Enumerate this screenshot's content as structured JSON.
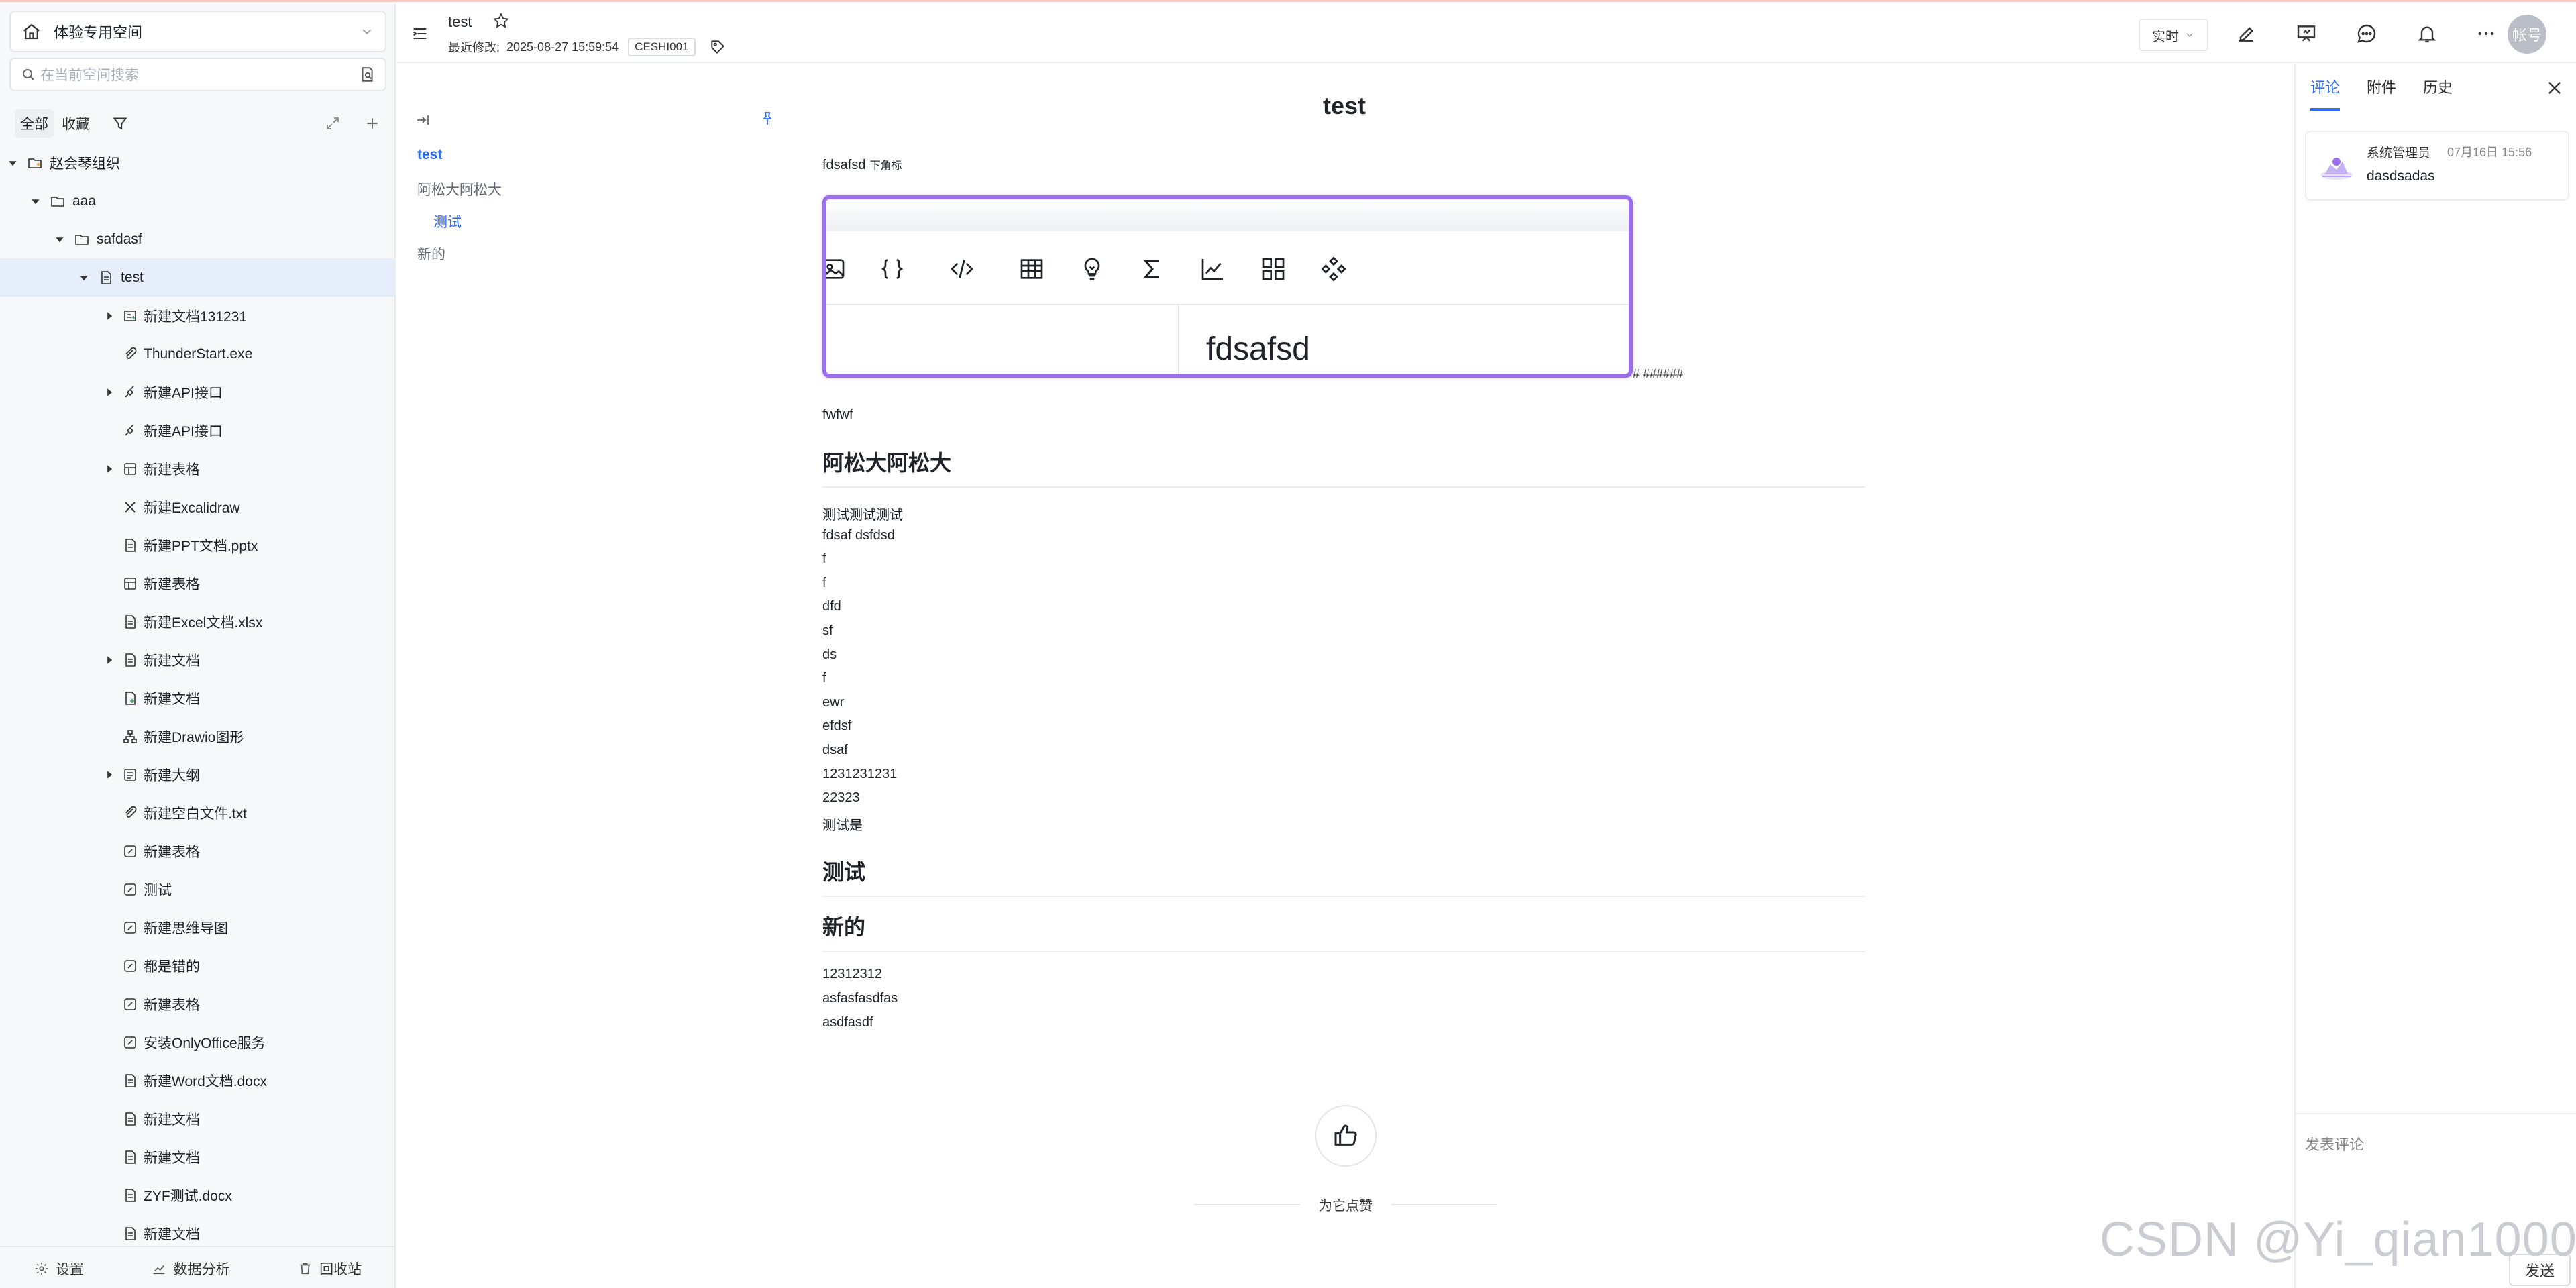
{
  "sidebar": {
    "space_name": "体验专用空间",
    "search_placeholder": "在当前空间搜索",
    "tabs": [
      "全部",
      "收藏"
    ],
    "tree": [
      {
        "label": "赵会琴组织",
        "icon": "folder-owner-icon"
      },
      {
        "label": "aaa",
        "icon": "folder-icon"
      },
      {
        "label": "safdasf",
        "icon": "folder-icon"
      },
      {
        "label": "test",
        "icon": "document-icon"
      },
      {
        "label": "新建文档131231",
        "icon": "document-plus-icon"
      },
      {
        "label": "ThunderStart.exe",
        "icon": "attachment-icon"
      },
      {
        "label": "新建API接口",
        "icon": "api-icon"
      },
      {
        "label": "新建API接口",
        "icon": "api-icon"
      },
      {
        "label": "新建表格",
        "icon": "sheet-icon"
      },
      {
        "label": "新建Excalidraw",
        "icon": "excalidraw-icon"
      },
      {
        "label": "新建PPT文档.pptx",
        "icon": "ppt-file-icon"
      },
      {
        "label": "新建表格",
        "icon": "sheet-icon"
      },
      {
        "label": "新建Excel文档.xlsx",
        "icon": "excel-file-icon"
      },
      {
        "label": "新建文档",
        "icon": "document-icon"
      },
      {
        "label": "新建文档",
        "icon": "document-plus-icon"
      },
      {
        "label": "新建Drawio图形",
        "icon": "drawio-icon"
      },
      {
        "label": "新建大纲",
        "icon": "outline-icon"
      },
      {
        "label": "新建空白文件.txt",
        "icon": "attachment-icon"
      },
      {
        "label": "新建表格",
        "icon": "sheet-edit-icon"
      },
      {
        "label": "测试",
        "icon": "sheet-edit-icon"
      },
      {
        "label": "新建思维导图",
        "icon": "sheet-edit-icon"
      },
      {
        "label": "都是错的",
        "icon": "sheet-edit-icon"
      },
      {
        "label": "新建表格",
        "icon": "sheet-edit-icon"
      },
      {
        "label": "安装OnlyOffice服务",
        "icon": "sheet-edit-icon"
      },
      {
        "label": "新建Word文档.docx",
        "icon": "word-file-icon"
      },
      {
        "label": "新建文档",
        "icon": "document-icon"
      },
      {
        "label": "新建文档",
        "icon": "document-icon"
      },
      {
        "label": "ZYF测试.docx",
        "icon": "word-file-icon"
      },
      {
        "label": "新建文档",
        "icon": "document-icon"
      }
    ],
    "bottom": {
      "settings": "设置",
      "analytics": "数据分析",
      "recycle": "回收站"
    }
  },
  "header": {
    "title": "test",
    "last_modified_label": "最近修改:",
    "last_modified_time": "2025-08-27 15:59:54",
    "tag": "CESHI001",
    "mode": "实时",
    "avatar": "帐号"
  },
  "outline": {
    "items": [
      "test",
      "阿松大阿松大",
      "测试",
      "新的"
    ]
  },
  "document": {
    "title": "test",
    "intro_text": "fdsafsd",
    "intro_sub": "下角标",
    "embed_cell": "fdsafsd",
    "hashes": "# ######",
    "line_fwfwf": "fwfwf",
    "h_main": "阿松大阿松大",
    "lines": [
      "测试测试测试",
      "fdsaf dsfdsd",
      "f",
      "f",
      "dfd",
      "sf",
      "ds",
      "f",
      "ewr",
      "efdsf",
      "dsaf",
      "1231231231",
      "22323",
      "测试是"
    ],
    "h_test": "测试",
    "h_new": "新的",
    "tail_lines": [
      "12312312",
      "asfasfasdfas",
      "asdfasdf"
    ],
    "like_text": "为它点赞"
  },
  "right_panel": {
    "tabs": [
      "评论",
      "附件",
      "历史"
    ],
    "comment": {
      "user": "系统管理员",
      "time": "07月16日 15:56",
      "text": "dasdsadas"
    },
    "input_placeholder": "发表评论",
    "send": "发送"
  },
  "watermark": "CSDN @Yi_qian1000",
  "colors": {
    "accent": "#2d6cf6",
    "embed_border": "#9b6ef0",
    "selected_bg": "#e6eefc"
  }
}
